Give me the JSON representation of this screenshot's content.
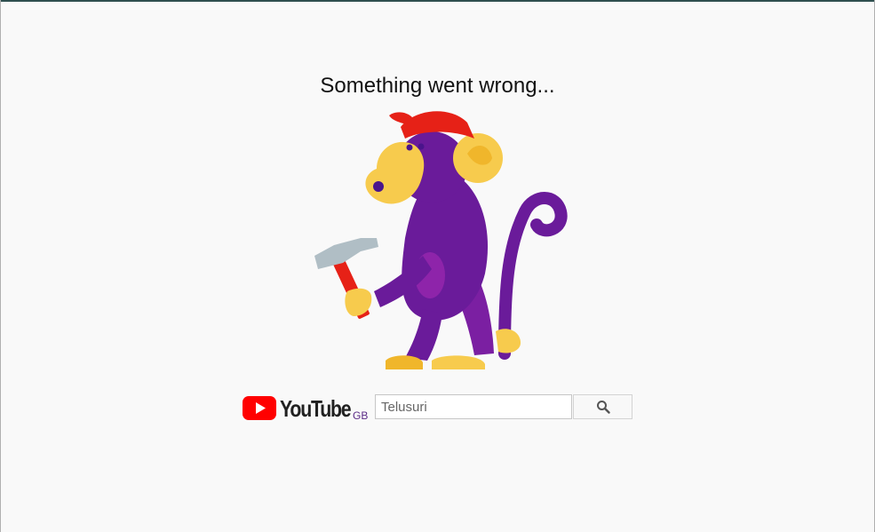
{
  "error": {
    "title": "Something went wrong..."
  },
  "illustration": {
    "name": "monkey-with-hammer",
    "colors": {
      "body": "#6a1b9a",
      "face": "#f7cb4d",
      "cap": "#e62117",
      "hammer_head": "#b0bec5",
      "hammer_handle": "#e62117"
    }
  },
  "logo": {
    "wordmark": "YouTube",
    "country_code": "GB",
    "brand_color": "#ff0000"
  },
  "search": {
    "placeholder": "Telusuri",
    "value": "",
    "button_icon": "search-icon"
  }
}
